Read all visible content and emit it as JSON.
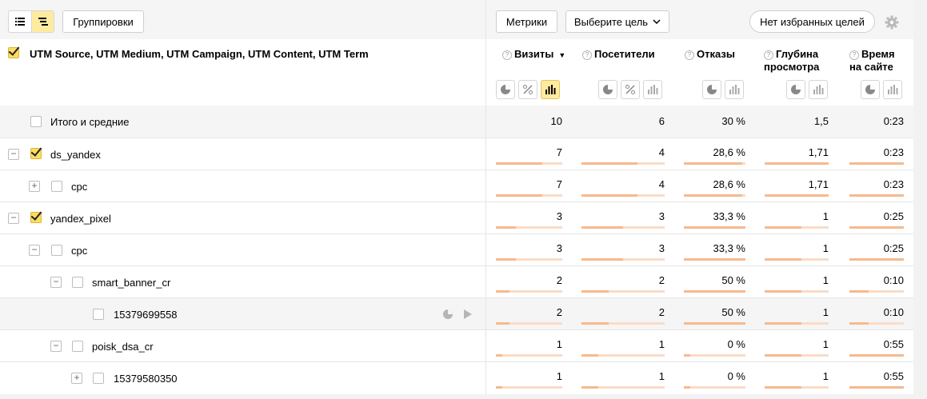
{
  "toolbar": {
    "groupings_label": "Группировки",
    "metrics_label": "Метрики",
    "goal_select_label": "Выберите цель",
    "favorites_label": "Нет избранных целей"
  },
  "header": {
    "title": "UTM Source, UTM Medium, UTM Campaign, UTM Content, UTM Term",
    "metrics": [
      {
        "line1": "Визиты",
        "line2": ""
      },
      {
        "line1": "Посетители",
        "line2": ""
      },
      {
        "line1": "Отказы",
        "line2": ""
      },
      {
        "line1": "Глубина",
        "line2": "просмотра"
      },
      {
        "line1": "Время",
        "line2": "на сайте"
      }
    ]
  },
  "total": {
    "label": "Итого и средние",
    "values": [
      "10",
      "6",
      "30 %",
      "1,5",
      "0:23"
    ]
  },
  "rows": [
    {
      "label": "ds_yandex",
      "values": [
        "7",
        "4",
        "28,6 %",
        "1,71",
        "0:23"
      ],
      "checked": true,
      "fills": [
        0.7,
        0.67,
        0.95,
        1.0,
        1.0
      ]
    },
    {
      "label": "cpc",
      "values": [
        "7",
        "4",
        "28,6 %",
        "1,71",
        "0:23"
      ],
      "checked": false,
      "fills": [
        0.7,
        0.67,
        0.95,
        1.0,
        1.0
      ]
    },
    {
      "label": "yandex_pixel",
      "values": [
        "3",
        "3",
        "33,3 %",
        "1",
        "0:25"
      ],
      "checked": true,
      "fills": [
        0.3,
        0.5,
        1.0,
        0.58,
        1.0
      ]
    },
    {
      "label": "cpc",
      "values": [
        "3",
        "3",
        "33,3 %",
        "1",
        "0:25"
      ],
      "checked": false,
      "fills": [
        0.3,
        0.5,
        1.0,
        0.58,
        1.0
      ]
    },
    {
      "label": "smart_banner_cr",
      "values": [
        "2",
        "2",
        "50 %",
        "1",
        "0:10"
      ],
      "checked": false,
      "fills": [
        0.2,
        0.33,
        1.0,
        0.58,
        0.35
      ]
    },
    {
      "label": "15379699558",
      "values": [
        "2",
        "2",
        "50 %",
        "1",
        "0:10"
      ],
      "checked": false,
      "fills": [
        0.2,
        0.33,
        1.0,
        0.58,
        0.35
      ]
    },
    {
      "label": "poisk_dsa_cr",
      "values": [
        "1",
        "1",
        "0 %",
        "1",
        "0:55"
      ],
      "checked": false,
      "fills": [
        0.1,
        0.2,
        0.1,
        0.58,
        1.0
      ]
    },
    {
      "label": "15379580350",
      "values": [
        "1",
        "1",
        "0 %",
        "1",
        "0:55"
      ],
      "checked": false,
      "fills": [
        0.1,
        0.2,
        0.1,
        0.58,
        1.0
      ]
    }
  ]
}
